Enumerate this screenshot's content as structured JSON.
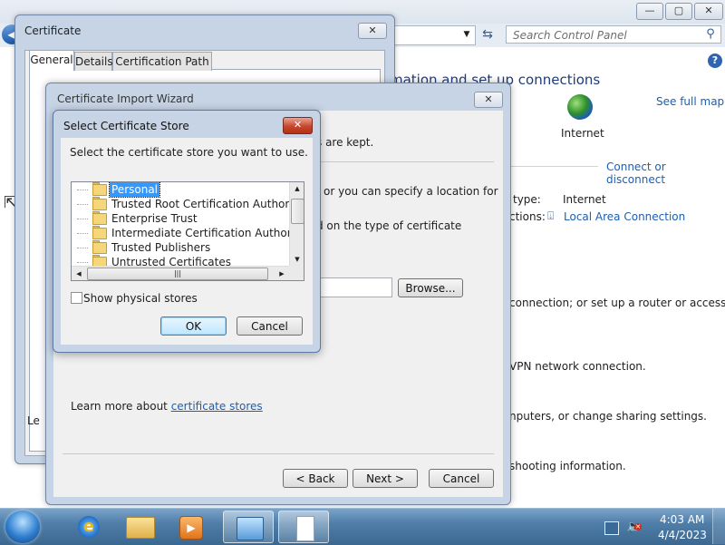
{
  "control_panel": {
    "search_placeholder": "Search Control Panel",
    "help_label": "?",
    "heading": "mation and set up connections",
    "see_full_map": "See full map",
    "internet_label": "Internet",
    "connect_or_disconnect": "Connect or disconnect",
    "access_type_label": "type:",
    "access_type_value": "Internet",
    "connections_label": "ctions:",
    "connection_link": "Local Area Connection",
    "text1": "connection; or set up a router or access",
    "text2": "VPN network connection.",
    "text3": "nputers, or change sharing settings.",
    "text4": "shooting information."
  },
  "certificate_window": {
    "title": "Certificate",
    "tabs": [
      {
        "label": "General"
      },
      {
        "label": "Details"
      },
      {
        "label": "Certification Path"
      }
    ],
    "left_text": "Le"
  },
  "import_wizard": {
    "title": "Certificate Import Wizard",
    "store_kept_text": "s are kept.",
    "line_a": "or you can specify a location for",
    "line_b": "d on the type of certificate",
    "browse_label": "Browse...",
    "learn_more_prefix": "Learn more about ",
    "learn_more_link": "certificate stores",
    "back_label": "< Back",
    "next_label": "Next >",
    "cancel_label": "Cancel"
  },
  "select_store_dialog": {
    "title": "Select Certificate Store",
    "instruction": "Select the certificate store you want to use.",
    "stores": [
      {
        "label": "Personal",
        "selected": true
      },
      {
        "label": "Trusted Root Certification Authorities",
        "selected": false
      },
      {
        "label": "Enterprise Trust",
        "selected": false
      },
      {
        "label": "Intermediate Certification Authorities",
        "selected": false
      },
      {
        "label": "Trusted Publishers",
        "selected": false
      },
      {
        "label": "Untrusted Certificates",
        "selected": false
      }
    ],
    "show_physical_stores": "Show physical stores",
    "show_physical_checked": false,
    "ok_label": "OK",
    "cancel_label": "Cancel"
  },
  "taskbar": {
    "items": [
      "internet-explorer",
      "windows-explorer",
      "windows-media-player",
      "control-panel",
      "document"
    ],
    "time": "4:03 AM",
    "date": "4/4/2023"
  }
}
